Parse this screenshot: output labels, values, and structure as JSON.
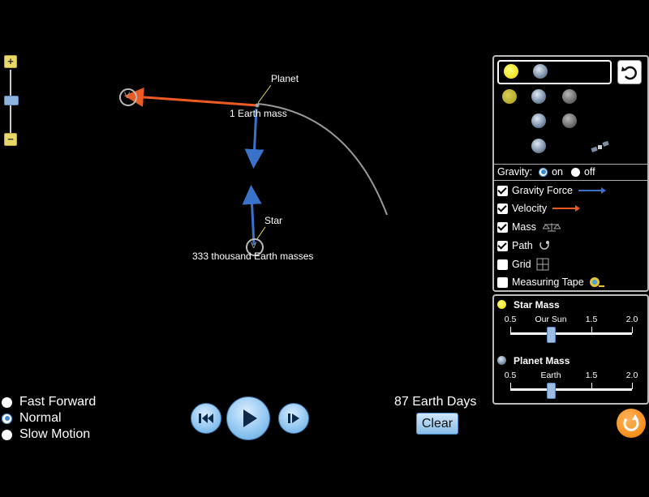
{
  "simulation": {
    "planet_label": "Planet",
    "planet_mass_label": "1 Earth mass",
    "star_label": "Star",
    "star_mass_label": "333 thousand Earth masses",
    "velocity_marker": "V"
  },
  "zoom": {
    "plus": "+",
    "minus": "−"
  },
  "panel": {
    "gravity": {
      "label": "Gravity:",
      "on_label": "on",
      "off_label": "off",
      "selected": "on"
    },
    "checkboxes": [
      {
        "label": "Gravity Force",
        "checked": true
      },
      {
        "label": "Velocity",
        "checked": true
      },
      {
        "label": "Mass",
        "checked": true
      },
      {
        "label": "Path",
        "checked": true
      },
      {
        "label": "Grid",
        "checked": false
      },
      {
        "label": "Measuring Tape",
        "checked": false
      }
    ],
    "colors": {
      "gravity_force": "#3b72c9",
      "velocity": "#ee5a24",
      "path": "#aaaaaa"
    }
  },
  "star_mass": {
    "title": "Star Mass",
    "ticks": [
      "0.5",
      "Our Sun",
      "1.5",
      "2.0"
    ],
    "value": 1.0
  },
  "planet_mass": {
    "title": "Planet Mass",
    "ticks": [
      "0.5",
      "Earth",
      "1.5",
      "2.0"
    ],
    "value": 1.0
  },
  "speed": {
    "options": [
      "Fast Forward",
      "Normal",
      "Slow Motion"
    ],
    "selected": "Normal"
  },
  "time": {
    "readout": "87 Earth Days"
  },
  "buttons": {
    "clear": "Clear"
  }
}
